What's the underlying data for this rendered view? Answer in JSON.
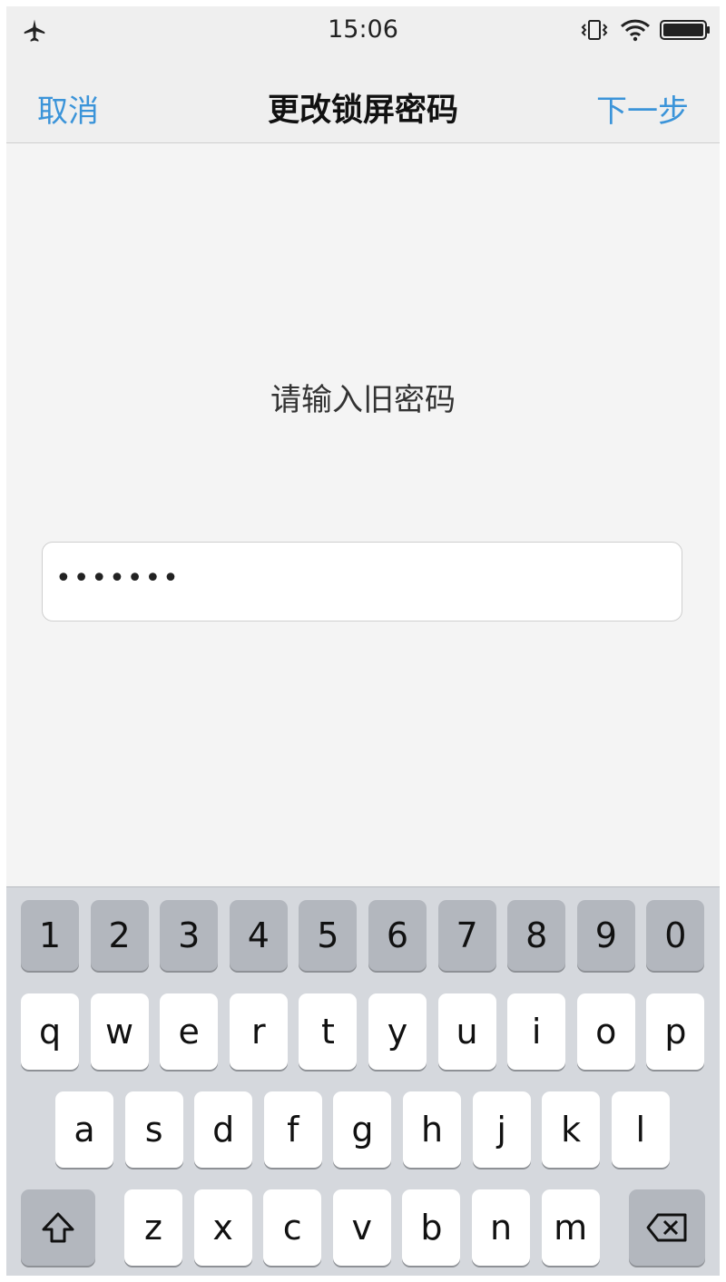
{
  "status_bar": {
    "time": "15:06",
    "icons": [
      "airplane-icon",
      "vibrate-icon",
      "wifi-icon",
      "battery-icon"
    ]
  },
  "nav": {
    "cancel_label": "取消",
    "title": "更改锁屏密码",
    "next_label": "下一步"
  },
  "main": {
    "prompt": "请输入旧密码",
    "password_masked": "•••••••"
  },
  "keyboard": {
    "number_row": [
      "1",
      "2",
      "3",
      "4",
      "5",
      "6",
      "7",
      "8",
      "9",
      "0"
    ],
    "row1": [
      "q",
      "w",
      "e",
      "r",
      "t",
      "y",
      "u",
      "i",
      "o",
      "p"
    ],
    "row2": [
      "a",
      "s",
      "d",
      "f",
      "g",
      "h",
      "j",
      "k",
      "l"
    ],
    "row3": [
      "z",
      "x",
      "c",
      "v",
      "b",
      "n",
      "m"
    ],
    "shift_icon": "shift-icon",
    "backspace_icon": "backspace-icon"
  },
  "colors": {
    "accent": "#3b94d9",
    "keyboard_bg": "#d5d8dd",
    "key_light": "#ffffff",
    "key_dark": "#b3b7be"
  }
}
